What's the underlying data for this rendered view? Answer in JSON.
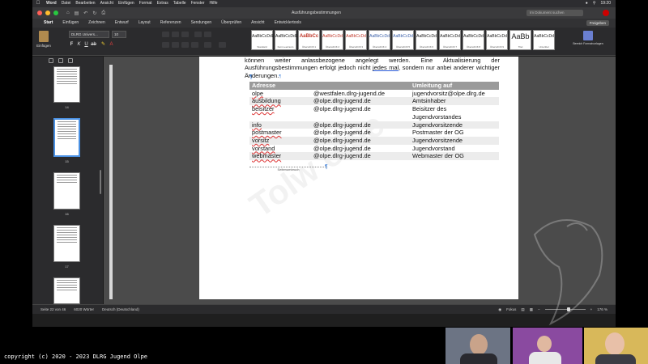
{
  "menubar": {
    "items": [
      "Word",
      "Datei",
      "Bearbeiten",
      "Ansicht",
      "Einfügen",
      "Format",
      "Extras",
      "Tabelle",
      "Fenster",
      "Hilfe"
    ],
    "clock": "19:20"
  },
  "window": {
    "title": "Ausführungsbestimmungen",
    "search_placeholder": "Im Dokument suchen"
  },
  "ribbon": {
    "tabs": [
      "Start",
      "Einfügen",
      "Zeichnen",
      "Entwurf",
      "Layout",
      "Referenzen",
      "Sendungen",
      "Überprüfen",
      "Ansicht",
      "Entwicklertools"
    ],
    "active_tab": "Start",
    "share_label": "Freigeben",
    "paste_label": "Einfügen",
    "font_name": "DLRG Univers...",
    "font_size": "10",
    "styles": [
      {
        "sample": "AaBbCcDdE",
        "label": "Standard",
        "color": "#222222"
      },
      {
        "sample": "AaBbCcDdEe",
        "label": "Kein Leerraum",
        "color": "#222222"
      },
      {
        "sample": "AaBbCc",
        "label": "Überschrift 1",
        "color": "#c0392b"
      },
      {
        "sample": "AaBbCcDd",
        "label": "Überschrift 2",
        "color": "#c0392b"
      },
      {
        "sample": "AaBbCcDd",
        "label": "Überschrift 3",
        "color": "#c0392b"
      },
      {
        "sample": "AaBbCcDd",
        "label": "Überschrift 4",
        "color": "#3a5fa8"
      },
      {
        "sample": "AaBbCcDd",
        "label": "Überschrift 5",
        "color": "#3a5fa8"
      },
      {
        "sample": "AaBbCcDd",
        "label": "Überschrift 6",
        "color": "#222222"
      },
      {
        "sample": "AaBbCcDd",
        "label": "Überschrift 7",
        "color": "#222222"
      },
      {
        "sample": "AaBbCcDd",
        "label": "Überschrift 8",
        "color": "#222222"
      },
      {
        "sample": "AaBbCcDd",
        "label": "Überschrift 9",
        "color": "#222222"
      },
      {
        "sample": "AaBb",
        "label": "Titel",
        "color": "#222222"
      },
      {
        "sample": "AaBbCcDd",
        "label": "Untertitel",
        "color": "#222222"
      }
    ],
    "styles_pane_label": "Bereich Formatvorlagen"
  },
  "sidebar": {
    "thumbnails": [
      {
        "page": "14",
        "selected": false
      },
      {
        "page": "15",
        "selected": true
      },
      {
        "page": "16",
        "selected": false
      },
      {
        "page": "17",
        "selected": false
      },
      {
        "page": "18",
        "selected": false
      }
    ]
  },
  "document": {
    "para_before": "können weiter anlassbezogene angelegt werden. Eine Aktualisierung der Ausführungsbestimmungen erfolgt jedoch nicht ",
    "para_underlined": "jedes mal",
    "para_after": ", sondern nur anbei anderer wichtiger Änderungen.",
    "table_headers": [
      "Adresse",
      "",
      "Umleitung auf"
    ],
    "table_rows": [
      [
        "olpe",
        "@westfalen.dlrg-jugend.de",
        "jugendvorsitz@olpe.dlrg.de"
      ],
      [
        "ausbildung",
        "@olpe.dlrg-jugend.de",
        "Amtsinhaber"
      ],
      [
        "beisitzer",
        "@olpe.dlrg-jugend.de",
        "Beisitzer des"
      ],
      [
        "",
        "",
        "Jugendvorstandes"
      ],
      [
        "info",
        "@olpe.dlrg-jugend.de",
        "Jugendvorsitzende"
      ],
      [
        "postmaster",
        "@olpe.dlrg-jugend.de",
        "Postmaster der OG"
      ],
      [
        "vorsitz",
        "@olpe.dlrg-jugend.de",
        "Jugendvorsitzende"
      ],
      [
        "vorstand",
        "@olpe.dlrg-jugend.de",
        "Jugendvorstand"
      ],
      [
        "webmaster",
        "@olpe.dlrg-jugend.de",
        "Webmaster der OG"
      ]
    ],
    "page_break_label": "Seitenumbruch"
  },
  "status": {
    "page": "Seite 22 von 46",
    "words": "6020 Wörter",
    "language": "Deutsch (Deutschland)",
    "focus": "Fokus",
    "zoom": "176 %",
    "zoom_level": 0.6
  },
  "overlay": {
    "copyright": "copyright (c) 2020 - 2023 DLRG Jugend Olpe"
  }
}
